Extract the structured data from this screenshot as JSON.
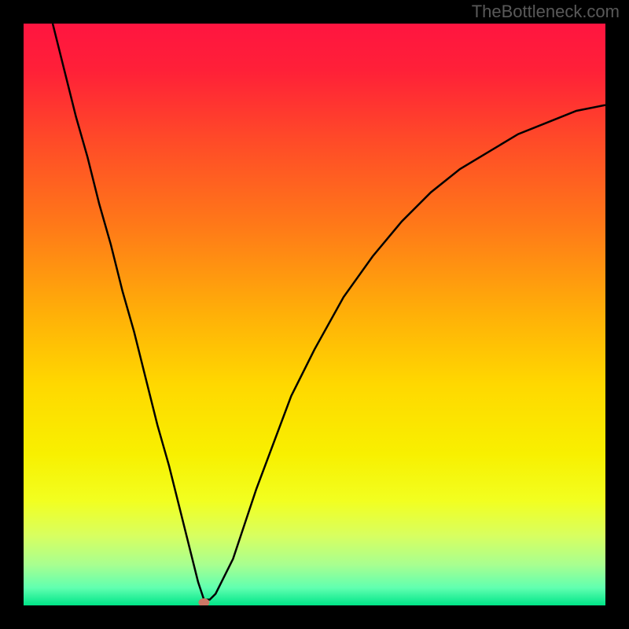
{
  "watermark": "TheBottleneck.com",
  "chart_data": {
    "type": "line",
    "title": "",
    "xlabel": "",
    "ylabel": "",
    "xlim": [
      0,
      100
    ],
    "ylim": [
      0,
      100
    ],
    "grid": false,
    "background_gradient": {
      "stops": [
        {
          "offset": 0.0,
          "color": "#ff1540"
        },
        {
          "offset": 0.08,
          "color": "#ff2038"
        },
        {
          "offset": 0.2,
          "color": "#ff4a28"
        },
        {
          "offset": 0.35,
          "color": "#ff7a18"
        },
        {
          "offset": 0.5,
          "color": "#ffb008"
        },
        {
          "offset": 0.62,
          "color": "#ffd800"
        },
        {
          "offset": 0.74,
          "color": "#f8f000"
        },
        {
          "offset": 0.82,
          "color": "#f2ff20"
        },
        {
          "offset": 0.88,
          "color": "#d8ff60"
        },
        {
          "offset": 0.93,
          "color": "#a8ff90"
        },
        {
          "offset": 0.97,
          "color": "#60ffb0"
        },
        {
          "offset": 1.0,
          "color": "#00e588"
        }
      ]
    },
    "series": [
      {
        "name": "bottleneck-curve",
        "stroke": "#000000",
        "stroke_width": 2.5,
        "x": [
          5,
          7,
          9,
          11,
          13,
          15,
          17,
          19,
          21,
          23,
          25,
          27,
          28,
          29,
          30,
          31,
          32,
          33,
          34,
          36,
          38,
          40,
          43,
          46,
          50,
          55,
          60,
          65,
          70,
          75,
          80,
          85,
          90,
          95,
          100
        ],
        "y": [
          100,
          92,
          84,
          77,
          69,
          62,
          54,
          47,
          39,
          31,
          24,
          16,
          12,
          8,
          4,
          1,
          1,
          2,
          4,
          8,
          14,
          20,
          28,
          36,
          44,
          53,
          60,
          66,
          71,
          75,
          78,
          81,
          83,
          85,
          86
        ]
      }
    ],
    "marker": {
      "name": "optimal-point",
      "x": 31,
      "y": 0.5,
      "color": "#cc7766",
      "radius": 7
    }
  }
}
